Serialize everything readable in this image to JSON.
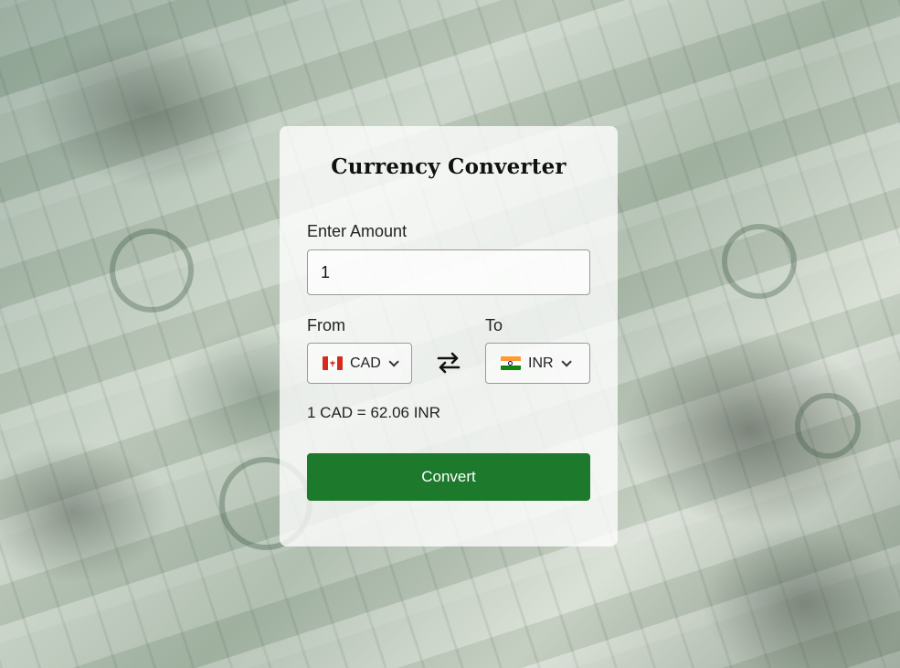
{
  "app": {
    "title": "Currency Converter"
  },
  "amount": {
    "label": "Enter Amount",
    "value": "1"
  },
  "from": {
    "label": "From",
    "currency": "CAD",
    "flag_icon": "canada-flag-icon"
  },
  "to": {
    "label": "To",
    "currency": "INR",
    "flag_icon": "india-flag-icon"
  },
  "rate_text": "1 CAD = 62.06 INR",
  "convert_button": {
    "label": "Convert"
  },
  "colors": {
    "accent": "#1d7a2c"
  }
}
